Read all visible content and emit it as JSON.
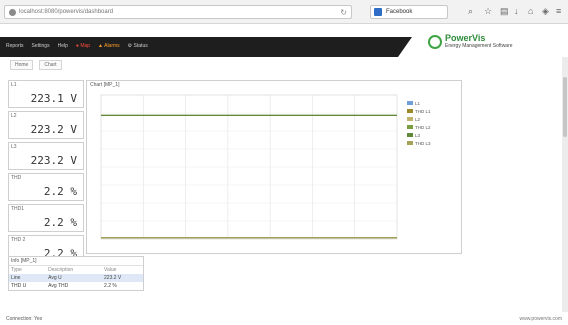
{
  "browser": {
    "url": "localhost:8080/powervis/dashboard",
    "search_text": "Facebook",
    "toolbar_icons": [
      "search-icon",
      "star-icon",
      "reader-icon",
      "download-icon",
      "home-icon",
      "extension-icon",
      "menu-icon"
    ]
  },
  "app": {
    "menu": [
      "Reports",
      "Settings",
      "Help"
    ],
    "alert_items": [
      "Map",
      "Alarms",
      "Status"
    ],
    "logo_name": "PowerVis",
    "logo_tagline": "Energy Management Software"
  },
  "tabs": [
    "Home",
    "Chart"
  ],
  "panels": [
    {
      "label": "L1",
      "value": "223.1 V"
    },
    {
      "label": "L2",
      "value": "223.2 V"
    },
    {
      "label": "L3",
      "value": "223.2 V"
    },
    {
      "label": "THD",
      "value": "2.2 %"
    },
    {
      "label": "THD1",
      "value": "2.2 %"
    },
    {
      "label": "THD 2",
      "value": "2.2 %"
    }
  ],
  "chart": {
    "title": "Chart [MP_1]"
  },
  "chart_data": {
    "type": "line",
    "title": "Chart [MP_1]",
    "x": [
      "",
      "",
      "",
      "",
      "",
      "",
      "",
      ""
    ],
    "ylim": [
      0,
      260
    ],
    "grid": true,
    "legend": "top-right",
    "series": [
      {
        "name": "L1",
        "color": "#6f9ed8",
        "values": [
          223.1,
          223.1,
          223.1,
          223.1,
          223.1,
          223.1,
          223.1,
          223.1
        ]
      },
      {
        "name": "THD L1",
        "color": "#9b8a2c",
        "values": [
          2.2,
          2.2,
          2.2,
          2.2,
          2.2,
          2.2,
          2.2,
          2.2
        ]
      },
      {
        "name": "L2",
        "color": "#c0b26b",
        "values": [
          223.2,
          223.2,
          223.2,
          223.2,
          223.2,
          223.2,
          223.2,
          223.2
        ]
      },
      {
        "name": "THD L2",
        "color": "#7a9e3f",
        "values": [
          2.2,
          2.2,
          2.2,
          2.2,
          2.2,
          2.2,
          2.2,
          2.2
        ]
      },
      {
        "name": "L3",
        "color": "#5f8a3a",
        "values": [
          223.2,
          223.2,
          223.2,
          223.2,
          223.2,
          223.2,
          223.2,
          223.2
        ]
      },
      {
        "name": "THD L3",
        "color": "#a7a25a",
        "values": [
          2.2,
          2.2,
          2.2,
          2.2,
          2.2,
          2.2,
          2.2,
          2.2
        ]
      }
    ]
  },
  "info_table": {
    "caption": "Info [MP_1]",
    "headers": [
      "Type",
      "Description",
      "Value"
    ],
    "rows": [
      [
        "Line",
        "Avg U",
        "223.2 V"
      ],
      [
        "THD U",
        "Avg THD",
        "2.2 %"
      ]
    ]
  },
  "footer": {
    "left": "Connection: Yes",
    "right": "www.powervis.com"
  }
}
